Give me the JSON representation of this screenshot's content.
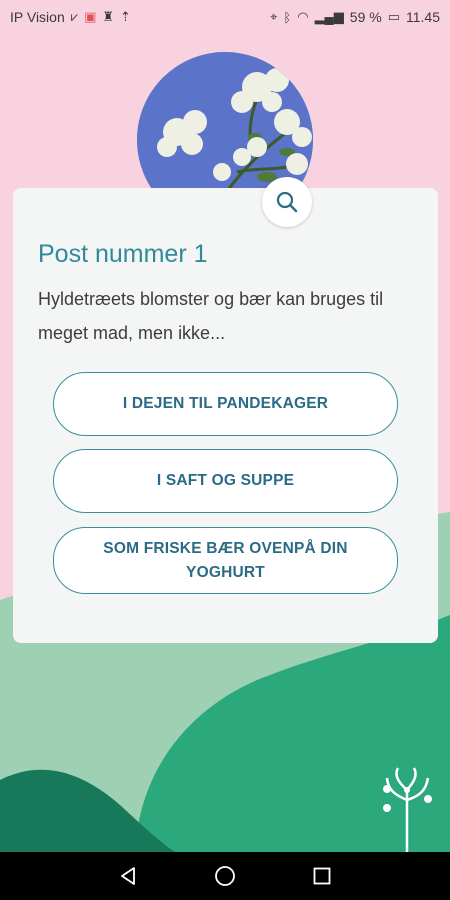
{
  "status_bar": {
    "carrier": "IP Vision",
    "battery": "59 %",
    "time": "11.45"
  },
  "card": {
    "title": "Post nummer 1",
    "question": "Hyldetræets blomster og bær kan bruges til meget mad, men ikke...",
    "answers": [
      {
        "label": "I DEJEN TIL PANDEKAGER"
      },
      {
        "label": "I SAFT OG SUPPE"
      },
      {
        "label": "SOM FRISKE BÆR OVENPÅ DIN YOGHURT"
      }
    ]
  },
  "icons": {
    "search": "search-icon",
    "back": "back-icon",
    "home": "home-icon",
    "recents": "recents-icon"
  },
  "colors": {
    "background_pink": "#f8d2df",
    "accent_teal": "#2f8a9b",
    "button_text": "#2a6b86",
    "hill_light": "#9ed0b3",
    "hill_mid": "#2ba87c",
    "hill_dark": "#17795a"
  }
}
